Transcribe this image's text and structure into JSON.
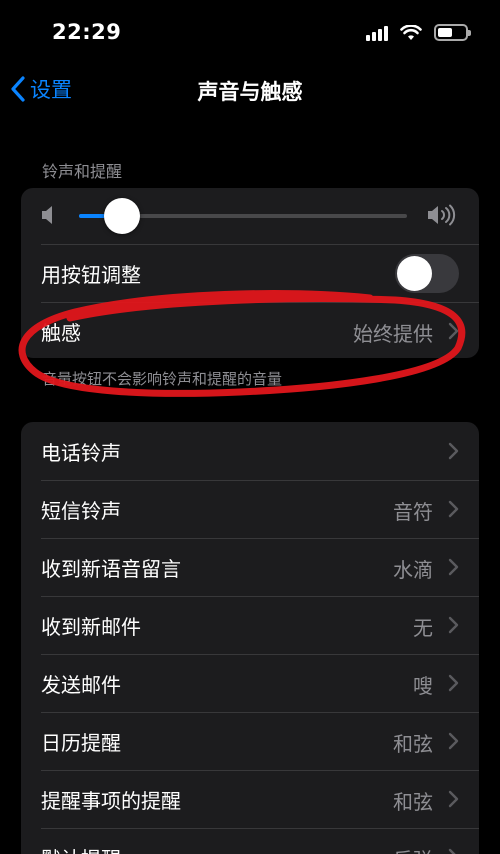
{
  "status_bar": {
    "time": "22:29",
    "battery_level": 0.55
  },
  "nav": {
    "back_label": "设置",
    "title": "声音与触感"
  },
  "ringtones_section": {
    "header": "铃声和提醒",
    "volume_level": 0.13,
    "adjust_with_buttons": {
      "label": "用按钮调整",
      "on": false
    },
    "haptics": {
      "label": "触感",
      "value": "始终提供"
    },
    "footer": "音量按钮不会影响铃声和提醒的音量"
  },
  "sounds": {
    "items": [
      {
        "label": "电话铃声",
        "value": ""
      },
      {
        "label": "短信铃声",
        "value": "音符"
      },
      {
        "label": "收到新语音留言",
        "value": "水滴"
      },
      {
        "label": "收到新邮件",
        "value": "无"
      },
      {
        "label": "发送邮件",
        "value": "嗖"
      },
      {
        "label": "日历提醒",
        "value": "和弦"
      },
      {
        "label": "提醒事项的提醒",
        "value": "和弦"
      },
      {
        "label": "默认提醒",
        "value": "反弹"
      }
    ]
  },
  "colors": {
    "accent": "#0a84ff",
    "annotation": "#e0161b",
    "cell_bg": "#1c1c1e"
  }
}
